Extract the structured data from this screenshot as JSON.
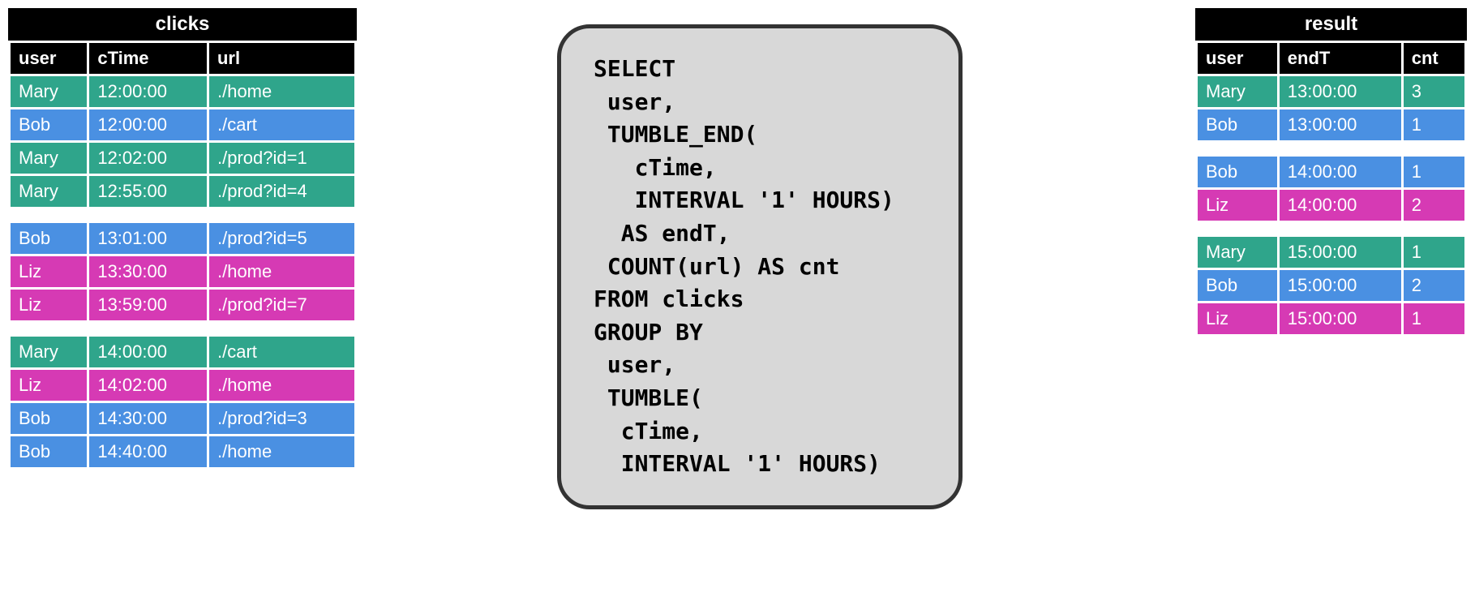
{
  "clicks": {
    "title": "clicks",
    "headers": [
      "user",
      "cTime",
      "url"
    ],
    "groups": [
      [
        {
          "user": "Mary",
          "cls": "mary",
          "cTime": "12:00:00",
          "url": "./home"
        },
        {
          "user": "Bob",
          "cls": "bob",
          "cTime": "12:00:00",
          "url": "./cart"
        },
        {
          "user": "Mary",
          "cls": "mary",
          "cTime": "12:02:00",
          "url": "./prod?id=1"
        },
        {
          "user": "Mary",
          "cls": "mary",
          "cTime": "12:55:00",
          "url": "./prod?id=4"
        }
      ],
      [
        {
          "user": "Bob",
          "cls": "bob",
          "cTime": "13:01:00",
          "url": "./prod?id=5"
        },
        {
          "user": "Liz",
          "cls": "liz",
          "cTime": "13:30:00",
          "url": "./home"
        },
        {
          "user": "Liz",
          "cls": "liz",
          "cTime": "13:59:00",
          "url": "./prod?id=7"
        }
      ],
      [
        {
          "user": "Mary",
          "cls": "mary",
          "cTime": "14:00:00",
          "url": "./cart"
        },
        {
          "user": "Liz",
          "cls": "liz",
          "cTime": "14:02:00",
          "url": "./home"
        },
        {
          "user": "Bob",
          "cls": "bob",
          "cTime": "14:30:00",
          "url": "./prod?id=3"
        },
        {
          "user": "Bob",
          "cls": "bob",
          "cTime": "14:40:00",
          "url": "./home"
        }
      ]
    ]
  },
  "sql": "SELECT\n user,\n TUMBLE_END(\n   cTime,\n   INTERVAL '1' HOURS)\n  AS endT,\n COUNT(url) AS cnt\nFROM clicks\nGROUP BY\n user,\n TUMBLE(\n  cTime,\n  INTERVAL '1' HOURS)",
  "result": {
    "title": "result",
    "headers": [
      "user",
      "endT",
      "cnt"
    ],
    "groups": [
      [
        {
          "user": "Mary",
          "cls": "mary",
          "endT": "13:00:00",
          "cnt": "3"
        },
        {
          "user": "Bob",
          "cls": "bob",
          "endT": "13:00:00",
          "cnt": "1"
        }
      ],
      [
        {
          "user": "Bob",
          "cls": "bob",
          "endT": "14:00:00",
          "cnt": "1"
        },
        {
          "user": "Liz",
          "cls": "liz",
          "endT": "14:00:00",
          "cnt": "2"
        }
      ],
      [
        {
          "user": "Mary",
          "cls": "mary",
          "endT": "15:00:00",
          "cnt": "1"
        },
        {
          "user": "Bob",
          "cls": "bob",
          "endT": "15:00:00",
          "cnt": "2"
        },
        {
          "user": "Liz",
          "cls": "liz",
          "endT": "15:00:00",
          "cnt": "1"
        }
      ]
    ]
  }
}
